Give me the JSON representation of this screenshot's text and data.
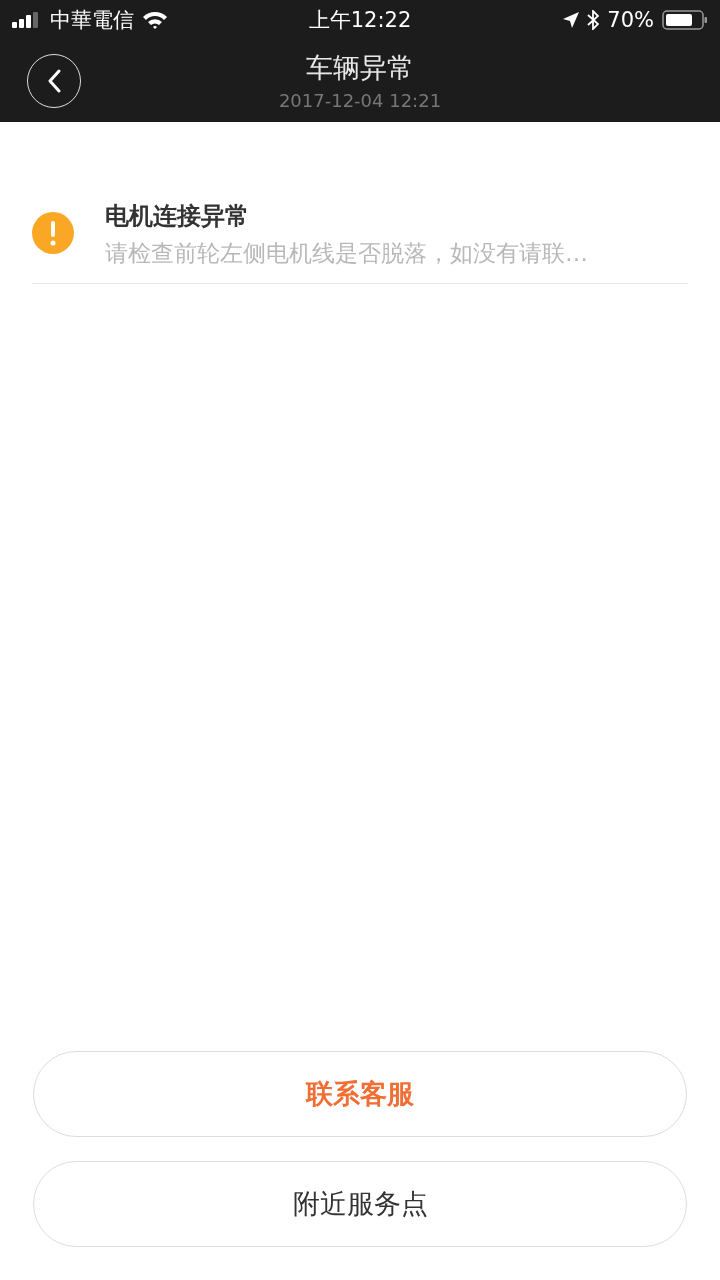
{
  "status_bar": {
    "carrier": "中華電信",
    "time": "上午12:22",
    "battery": "70%"
  },
  "header": {
    "title": "车辆异常",
    "subtitle": "2017-12-04 12:21"
  },
  "alerts": [
    {
      "kind": "warning",
      "title": "电机连接异常",
      "message": "请检查前轮左侧电机线是否脱落，如没有请联…"
    }
  ],
  "buttons": [
    {
      "label": "联系客服",
      "kind": "primary"
    },
    {
      "label": "附近服务点",
      "kind": "secondary"
    }
  ]
}
